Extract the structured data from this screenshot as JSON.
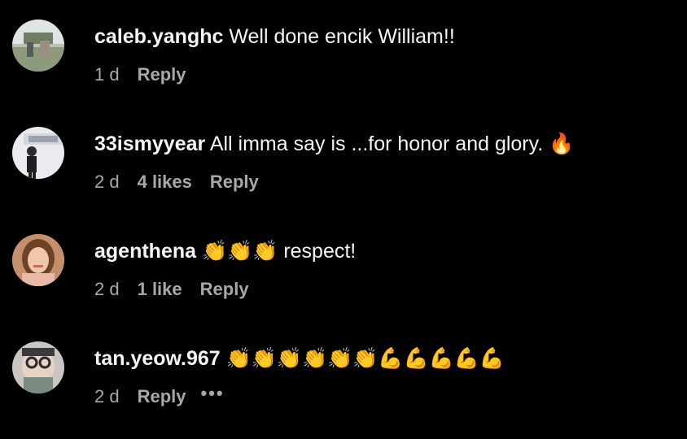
{
  "colors": {
    "background": "#000000",
    "primary_text": "#f5f5f5",
    "secondary_text": "#a8a8a8"
  },
  "comments": [
    {
      "username": "caleb.yanghc",
      "text": "Well done encik William!!",
      "time": "1 d",
      "reply_label": "Reply"
    },
    {
      "username": "33ismyyear",
      "text": "All imma say is ...for honor and glory. 🔥",
      "time": "2 d",
      "likes": "4 likes",
      "reply_label": "Reply"
    },
    {
      "username": "agenthena",
      "text": "👏👏👏 respect!",
      "time": "2 d",
      "likes": "1 like",
      "reply_label": "Reply"
    },
    {
      "username": "tan.yeow.967",
      "text": "👏👏👏👏👏👏💪💪💪💪💪",
      "time": "2 d",
      "reply_label": "Reply",
      "more_label": "•••"
    }
  ]
}
